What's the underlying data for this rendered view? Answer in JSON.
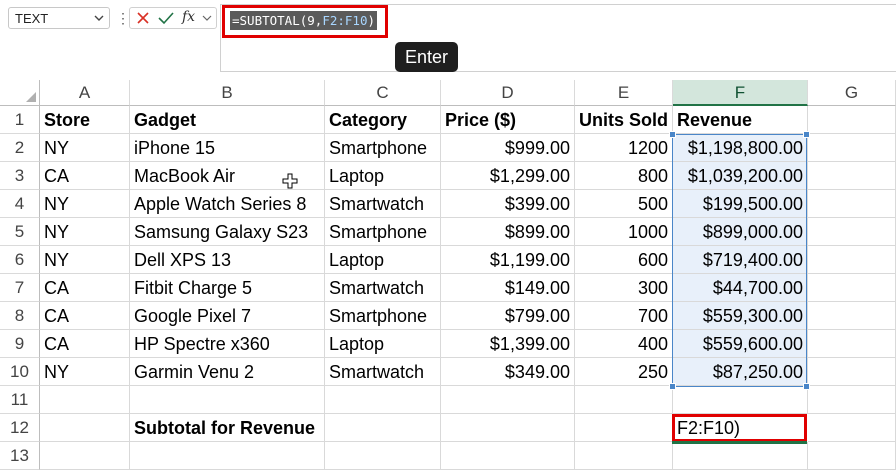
{
  "name_box": {
    "value": "TEXT"
  },
  "formula_bar": {
    "formula_prefix": "=SUBTOTAL(9,",
    "formula_ref": "F2:F10",
    "formula_suffix": ")"
  },
  "tooltip": "Enter",
  "columns": [
    "A",
    "B",
    "C",
    "D",
    "E",
    "F",
    "G"
  ],
  "rows": [
    "1",
    "2",
    "3",
    "4",
    "5",
    "6",
    "7",
    "8",
    "9",
    "10",
    "11",
    "12",
    "13"
  ],
  "headers": [
    "Store",
    "Gadget",
    "Category",
    "Price ($)",
    "Units Sold",
    "Revenue"
  ],
  "data": [
    [
      "NY",
      "iPhone 15",
      "Smartphone",
      "$999.00",
      "1200",
      "$1,198,800.00"
    ],
    [
      "CA",
      "MacBook Air",
      "Laptop",
      "$1,299.00",
      "800",
      "$1,039,200.00"
    ],
    [
      "NY",
      "Apple Watch Series 8",
      "Smartwatch",
      "$399.00",
      "500",
      "$199,500.00"
    ],
    [
      "NY",
      "Samsung Galaxy S23",
      "Smartphone",
      "$899.00",
      "1000",
      "$899,000.00"
    ],
    [
      "NY",
      "Dell XPS 13",
      "Laptop",
      "$1,199.00",
      "600",
      "$719,400.00"
    ],
    [
      "CA",
      "Fitbit Charge 5",
      "Smartwatch",
      "$149.00",
      "300",
      "$44,700.00"
    ],
    [
      "CA",
      "Google Pixel 7",
      "Smartphone",
      "$799.00",
      "700",
      "$559,300.00"
    ],
    [
      "CA",
      "HP Spectre x360",
      "Laptop",
      "$1,399.00",
      "400",
      "$559,600.00"
    ],
    [
      "NY",
      "Garmin Venu 2",
      "Smartwatch",
      "$349.00",
      "250",
      "$87,250.00"
    ]
  ],
  "subtotal_label": "Subtotal for Revenue",
  "active_cell_text": "F2:F10)",
  "colors": {
    "highlight": "#e00000",
    "selection": "#4a86c8",
    "accent": "#217346"
  }
}
